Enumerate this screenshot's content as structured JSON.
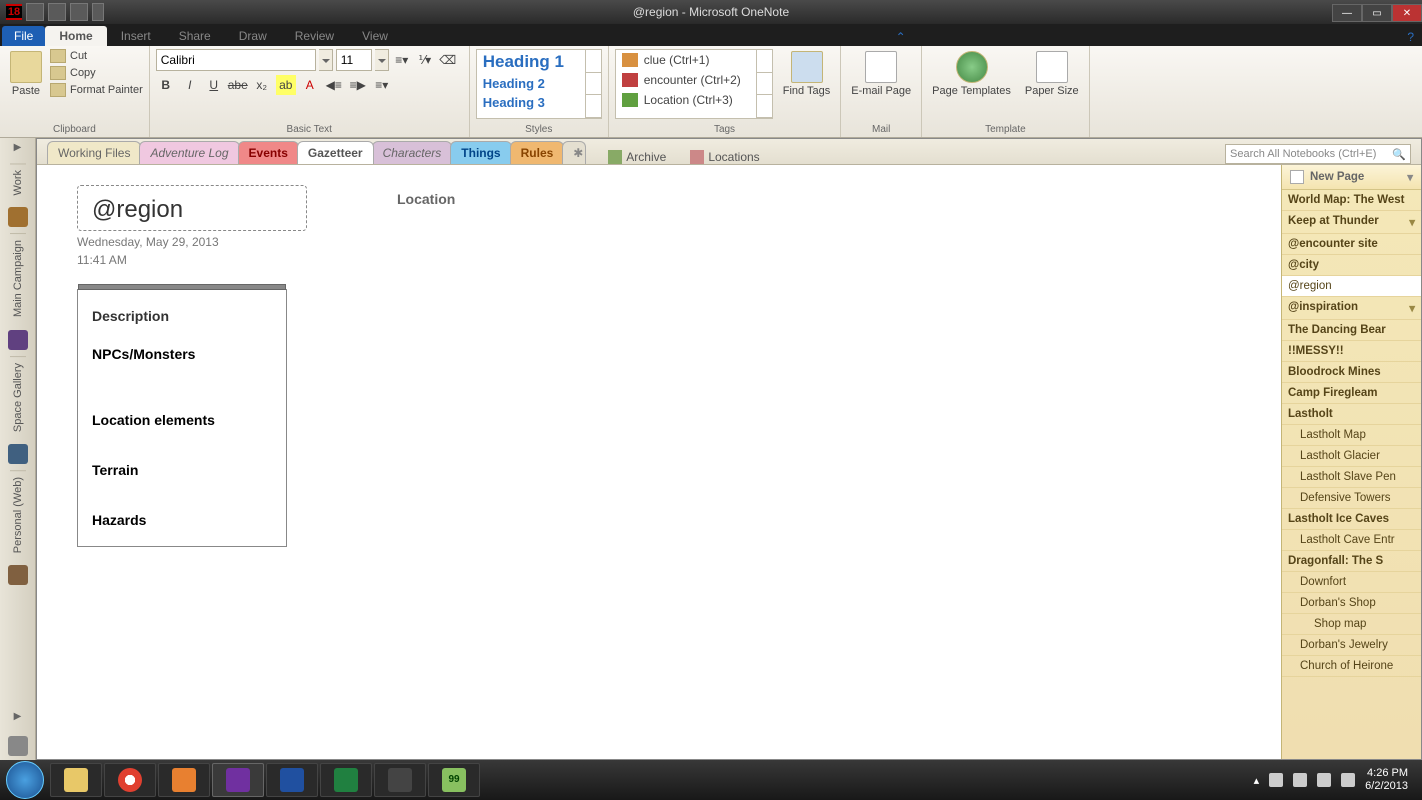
{
  "window": {
    "title": "@region - Microsoft OneNote",
    "app_badge": "18"
  },
  "ribbon": {
    "file": "File",
    "tabs": [
      "Home",
      "Insert",
      "Share",
      "Draw",
      "Review",
      "View"
    ],
    "active_tab": "Home",
    "clipboard": {
      "paste": "Paste",
      "cut": "Cut",
      "copy": "Copy",
      "format_painter": "Format Painter",
      "group": "Clipboard"
    },
    "basic_text": {
      "font": "Calibri",
      "size": "11",
      "group": "Basic Text"
    },
    "styles": {
      "items": [
        "Heading 1",
        "Heading 2",
        "Heading 3"
      ],
      "group": "Styles"
    },
    "tags": {
      "items": [
        "clue (Ctrl+1)",
        "encounter (Ctrl+2)",
        "Location (Ctrl+3)"
      ],
      "find": "Find Tags",
      "group": "Tags"
    },
    "mail": {
      "email": "E-mail Page",
      "group": "Mail"
    },
    "templates": {
      "page": "Page Templates",
      "paper": "Paper Size",
      "group": "Template"
    }
  },
  "nav_rail": [
    "Work",
    "Main Campaign",
    "Space Gallery",
    "Personal (Web)"
  ],
  "section_tabs": {
    "working": "Working Files",
    "adventure": "Adventure Log",
    "events": "Events",
    "gazetteer": "Gazetteer",
    "characters": "Characters",
    "things": "Things",
    "rules": "Rules",
    "archive": "Archive",
    "locations": "Locations"
  },
  "search": {
    "placeholder": "Search All Notebooks (Ctrl+E)"
  },
  "page": {
    "title": "@region",
    "date": "Wednesday, May 29, 2013",
    "time": "11:41 AM",
    "loc_label": "Location",
    "sections": {
      "description": "Description",
      "npcs": "NPCs/Monsters",
      "loc_elements": "Location elements",
      "terrain": "Terrain",
      "hazards": "Hazards"
    }
  },
  "page_list": {
    "new_page": "New Page",
    "items": [
      {
        "label": "World Map: The West",
        "bold": true
      },
      {
        "label": "Keep at Thunder",
        "bold": true,
        "chev": true
      },
      {
        "label": "@encounter site",
        "bold": true
      },
      {
        "label": "@city",
        "bold": true
      },
      {
        "label": "@region",
        "sel": true
      },
      {
        "label": "@inspiration",
        "bold": true,
        "chev": true
      },
      {
        "label": "The Dancing Bear",
        "bold": true
      },
      {
        "label": "!!MESSY!!",
        "bold": true
      },
      {
        "label": "Bloodrock Mines",
        "bold": true
      },
      {
        "label": "Camp Firegleam",
        "bold": true
      },
      {
        "label": "Lastholt",
        "bold": true
      },
      {
        "label": "Lastholt Map",
        "indent": 1
      },
      {
        "label": "Lastholt Glacier",
        "indent": 1
      },
      {
        "label": "Lastholt Slave Pen",
        "indent": 1
      },
      {
        "label": "Defensive Towers",
        "indent": 1
      },
      {
        "label": "Lastholt Ice Caves",
        "bold": true
      },
      {
        "label": "Lastholt Cave Entr",
        "indent": 1
      },
      {
        "label": "Dragonfall: The S",
        "bold": true
      },
      {
        "label": "Downfort",
        "indent": 1
      },
      {
        "label": "Dorban's Shop",
        "indent": 1
      },
      {
        "label": "Shop map",
        "indent": 2
      },
      {
        "label": "Dorban's Jewelry",
        "indent": 1
      },
      {
        "label": "Church of Heirone",
        "indent": 1
      }
    ]
  },
  "taskbar": {
    "time": "4:26 PM",
    "date": "6/2/2013"
  }
}
